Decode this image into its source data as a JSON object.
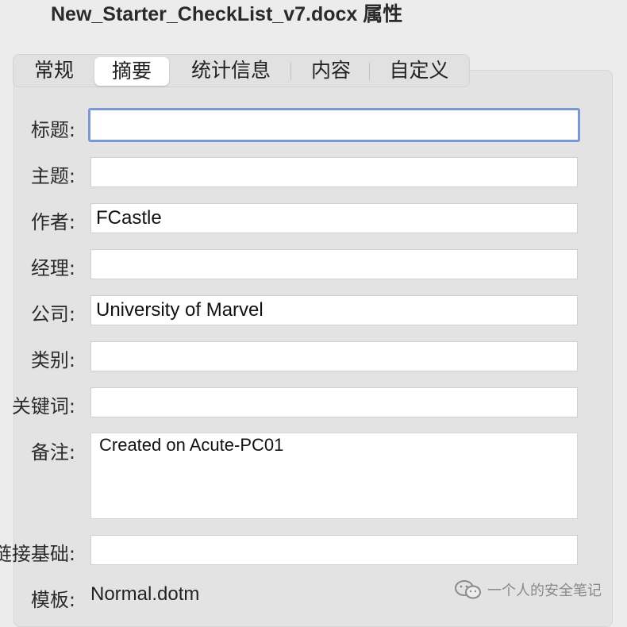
{
  "window": {
    "title": "New_Starter_CheckList_v7.docx 属性"
  },
  "tabs": [
    {
      "label": "常规"
    },
    {
      "label": "摘要"
    },
    {
      "label": "统计信息"
    },
    {
      "label": "内容"
    },
    {
      "label": "自定义"
    }
  ],
  "active_tab": "摘要",
  "fields": {
    "title": {
      "label": "标题:",
      "value": ""
    },
    "subject": {
      "label": "主题:",
      "value": ""
    },
    "author": {
      "label": "作者:",
      "value": "FCastle"
    },
    "manager": {
      "label": "经理:",
      "value": ""
    },
    "company": {
      "label": "公司:",
      "value": "University of Marvel"
    },
    "category": {
      "label": "类别:",
      "value": ""
    },
    "keywords": {
      "label": "关键词:",
      "value": ""
    },
    "comments": {
      "label": "备注:",
      "value": "Created on Acute-PC01"
    },
    "hyperlink_base": {
      "label": "链接基础:",
      "value": ""
    },
    "template": {
      "label": "模板:",
      "value": "Normal.dotm"
    }
  },
  "watermark": {
    "text": "一个人的安全笔记",
    "icon": "wechat-icon"
  },
  "colors": {
    "focus_ring": "#7c98d4",
    "panel": "#e3e3e3",
    "background": "#ececec"
  }
}
